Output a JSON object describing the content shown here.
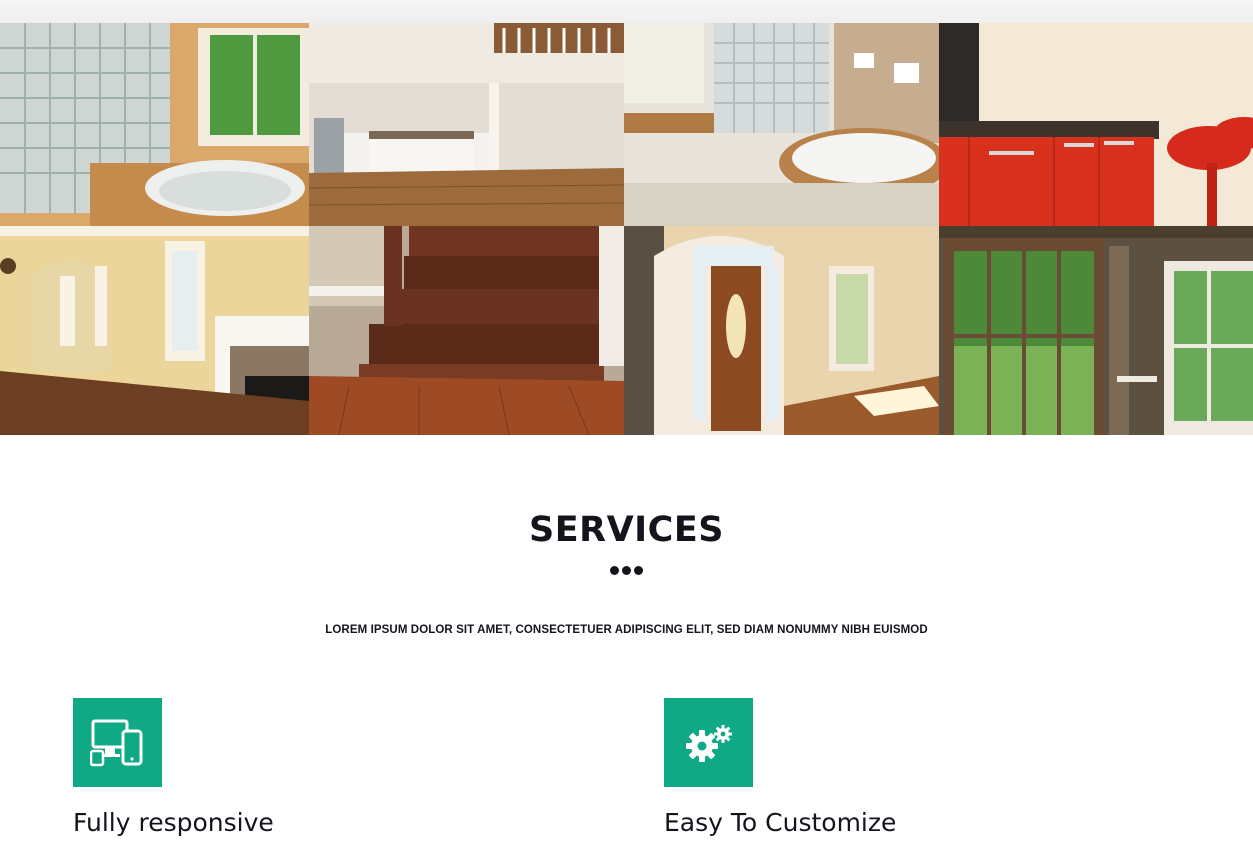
{
  "gallery": {
    "images": [
      {
        "name": "bathroom-glass-block-image"
      },
      {
        "name": "open-kitchen-image"
      },
      {
        "name": "bathroom-jacuzzi-image"
      },
      {
        "name": "red-kitchen-image"
      },
      {
        "name": "fireplace-room-image"
      },
      {
        "name": "staircase-image"
      },
      {
        "name": "front-door-image"
      },
      {
        "name": "window-room-image"
      }
    ]
  },
  "services": {
    "title": "SERVICES",
    "subtitle": "LOREM IPSUM DOLOR SIT AMET, CONSECTETUER ADIPISCING ELIT, SED DIAM NONUMMY NIBH EUISMOD",
    "accent_color": "#0fa985",
    "items": [
      {
        "icon": "devices-icon",
        "title": "Fully responsive"
      },
      {
        "icon": "gears-icon",
        "title": "Easy To Customize"
      }
    ]
  }
}
